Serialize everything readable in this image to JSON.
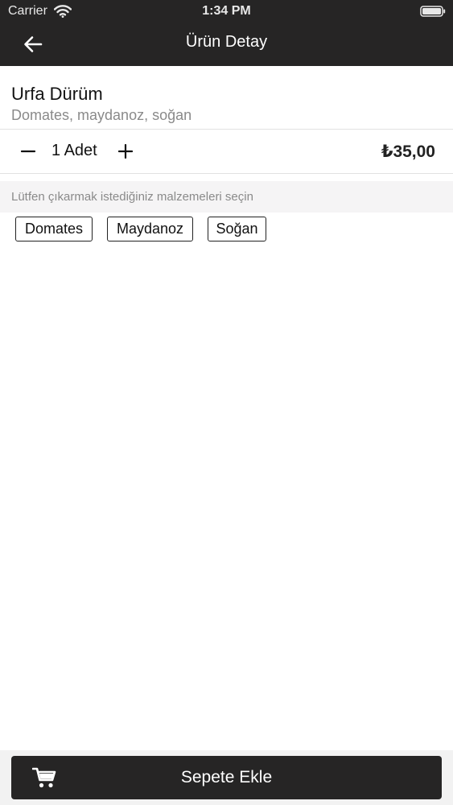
{
  "status_bar": {
    "carrier": "Carrier",
    "time": "1:34 PM"
  },
  "nav": {
    "title": "Ürün Detay"
  },
  "product": {
    "name": "Urfa Dürüm",
    "description": "Domates, maydanoz, soğan",
    "quantity_label": "1 Adet",
    "price": "₺35,00"
  },
  "ingredients": {
    "hint": "Lütfen çıkarmak istediğiniz malzemeleri seçin",
    "items": [
      "Domates",
      "Maydanoz",
      "Soğan"
    ]
  },
  "footer": {
    "add_to_cart_label": "Sepete Ekle"
  },
  "icons": {
    "back": "arrow-left-icon",
    "minus": "minus-icon",
    "plus": "plus-icon",
    "cart": "cart-icon",
    "wifi": "wifi-icon",
    "battery": "battery-icon"
  },
  "colors": {
    "header_bg": "#262525",
    "button_bg": "#262525",
    "hint_bg": "#f5f4f5",
    "secondary_text": "#8a8a8a"
  }
}
